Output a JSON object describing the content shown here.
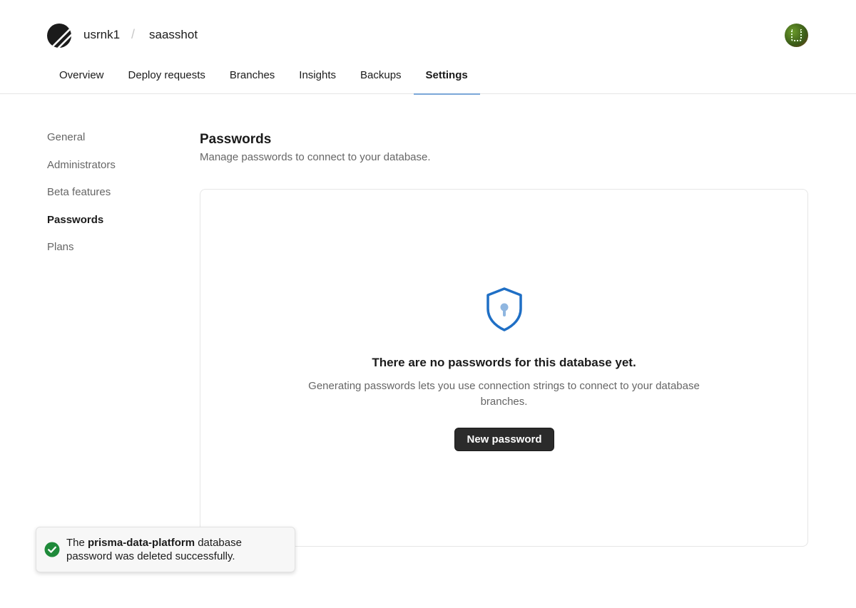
{
  "header": {
    "org": "usrnk1",
    "separator": "/",
    "database": "saasshot",
    "logo_icon": "planetscale-logo-icon",
    "avatar_icon": "user-avatar-icon"
  },
  "tabs": [
    {
      "label": "Overview"
    },
    {
      "label": "Deploy requests"
    },
    {
      "label": "Branches"
    },
    {
      "label": "Insights"
    },
    {
      "label": "Backups"
    },
    {
      "label": "Settings",
      "active": true
    }
  ],
  "sidebar": {
    "items": [
      {
        "label": "General"
      },
      {
        "label": "Administrators"
      },
      {
        "label": "Beta features"
      },
      {
        "label": "Passwords",
        "active": true
      },
      {
        "label": "Plans"
      }
    ]
  },
  "main": {
    "title": "Passwords",
    "subtitle": "Manage passwords to connect to your database.",
    "empty_icon": "shield-key-icon",
    "empty_title": "There are no passwords for this database yet.",
    "empty_description": "Generating passwords lets you use connection strings to connect to your database branches.",
    "new_button": "New password"
  },
  "toast": {
    "icon": "check-circle-icon",
    "prefix": "The ",
    "name": "prisma-data-platform",
    "suffix": " database password was deleted successfully."
  },
  "colors": {
    "accent": "#7aa7d8",
    "shield": "#1f6fc5",
    "button": "#2b2b2b",
    "success": "#1f8a3a"
  }
}
